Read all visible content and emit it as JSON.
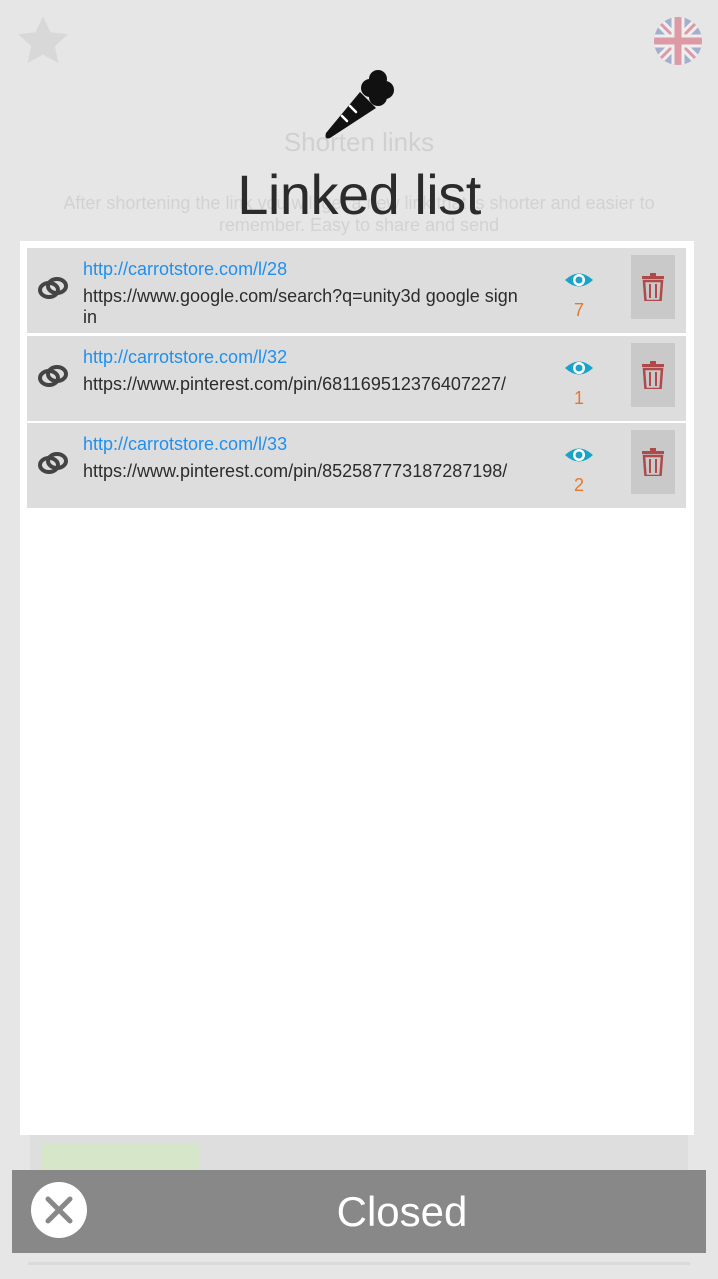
{
  "background": {
    "title": "Shorten links",
    "description": "After shortening the link you will get a new link that is shorter and easier to remember. Easy to share and send"
  },
  "header": {
    "title": "Linked list",
    "icon": "carrot-icon"
  },
  "links": [
    {
      "short": "http://carrotstore.com/l/28",
      "original": "https://www.google.com/search?q=unity3d google sign in",
      "views": "7"
    },
    {
      "short": "http://carrotstore.com/l/32",
      "original": "https://www.pinterest.com/pin/681169512376407227/",
      "views": "1"
    },
    {
      "short": "http://carrotstore.com/l/33",
      "original": "https://www.pinterest.com/pin/852587773187287198/",
      "views": "2"
    }
  ],
  "footer": {
    "close_label": "Closed"
  },
  "colors": {
    "short_link": "#1e90f0",
    "views": "#e8772e",
    "eye": "#1aa3c8",
    "trash": "#b04a4a",
    "close_bar": "#888888"
  }
}
